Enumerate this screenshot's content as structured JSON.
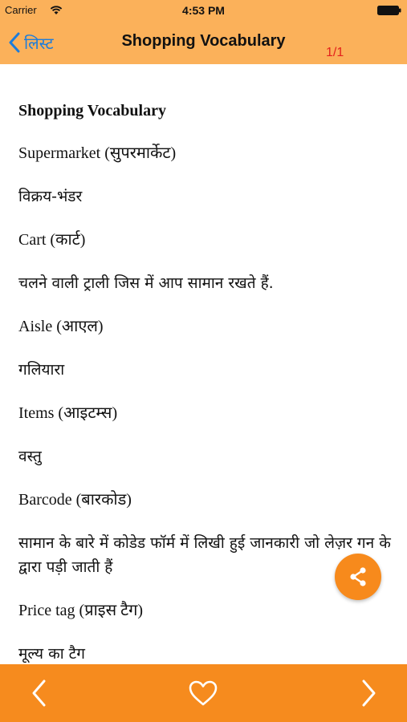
{
  "status_bar": {
    "carrier": "Carrier",
    "time": "4:53 PM"
  },
  "nav": {
    "back_label": "लिस्ट",
    "title": "Shopping Vocabulary",
    "page_counter": "1/1"
  },
  "content": {
    "heading": "Shopping Vocabulary",
    "entries": [
      "Supermarket (सुपरमार्केट)",
      "विक्रय-भंडर",
      "Cart (कार्ट)",
      "चलने वाली ट्राली जिस में आप सामान रखते हैं.",
      "Aisle (आएल)",
      "गलियारा",
      "Items (आइटम्स)",
      "वस्तु",
      "Barcode (बारकोड)",
      "सामान के बारे में कोडेड फॉर्म में लिखी हुई जानकारी जो लेज़र गन के द्वारा पड़ी जाती हैं",
      "Price tag (प्राइस टैग)",
      "मूल्य का टैग"
    ]
  },
  "icons": {
    "wifi": "wifi-icon",
    "battery": "battery-icon",
    "back": "chevron-left-icon",
    "share": "share-icon",
    "prev": "chevron-left-icon",
    "favorite": "heart-outline-icon",
    "next": "chevron-right-icon"
  },
  "colors": {
    "header_bg": "#fbb15a",
    "toolbar_bg": "#f68b1e",
    "back_link": "#1c7cdb",
    "page_counter": "#e3211c",
    "share_fab": "#f78a1c"
  }
}
